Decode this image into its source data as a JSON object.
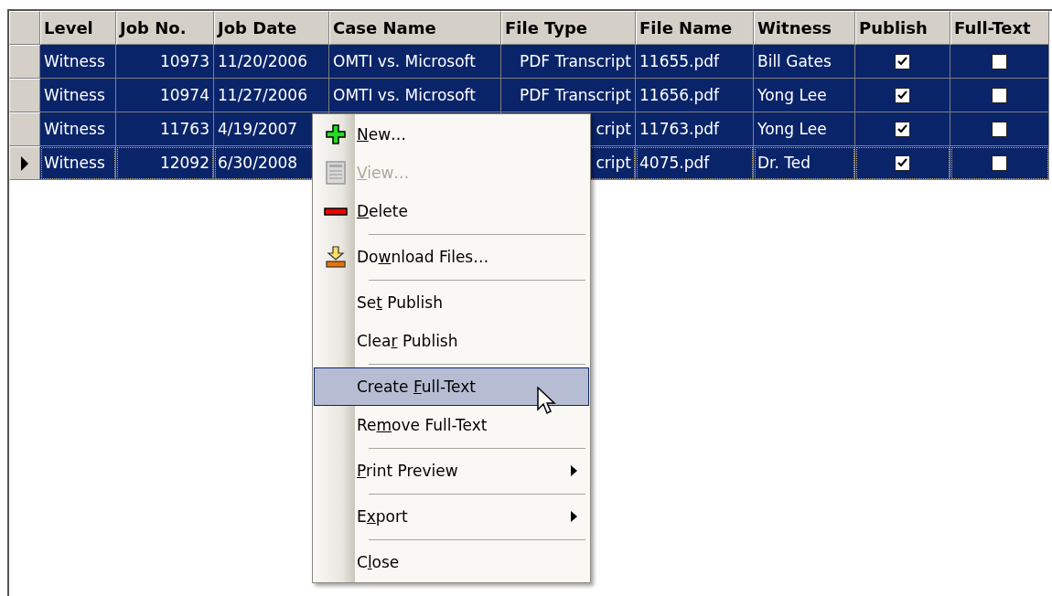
{
  "table": {
    "columns": [
      "Level",
      "Job No.",
      "Job Date",
      "Case Name",
      "File Type",
      "File Name",
      "Witness",
      "Publish",
      "Full-Text"
    ],
    "rows": [
      {
        "selected": true,
        "current": false,
        "level": "Witness",
        "job_no": "10973",
        "job_date": "11/20/2006",
        "case_name": "OMTI vs. Microsoft",
        "file_type": "PDF Transcript",
        "file_name": "11655.pdf",
        "witness": "Bill Gates",
        "publish": true,
        "full_text": false
      },
      {
        "selected": true,
        "current": false,
        "level": "Witness",
        "job_no": "10974",
        "job_date": "11/27/2006",
        "case_name": "OMTI vs. Microsoft",
        "file_type": "PDF Transcript",
        "file_name": "11656.pdf",
        "witness": "Yong Lee",
        "publish": true,
        "full_text": false
      },
      {
        "selected": true,
        "current": false,
        "level": "Witness",
        "job_no": "11763",
        "job_date": "4/19/2007",
        "file_type": "cript",
        "file_name": "11763.pdf",
        "witness": "Yong Lee",
        "publish": true,
        "full_text": false
      },
      {
        "selected": true,
        "current": true,
        "level": "Witness",
        "job_no": "12092",
        "job_date": "6/30/2008",
        "file_type": "cript",
        "file_name": "4075.pdf",
        "witness": "Dr. Ted",
        "publish": true,
        "full_text": false
      }
    ]
  },
  "context_menu": {
    "items": [
      {
        "kind": "command",
        "label": "New…",
        "disabled": false,
        "selected": false
      },
      {
        "kind": "command",
        "label": "View…",
        "disabled": true,
        "selected": false
      },
      {
        "kind": "command",
        "label": "Delete",
        "disabled": false,
        "selected": false
      },
      {
        "kind": "separator"
      },
      {
        "kind": "command",
        "label": "Download Files…",
        "disabled": false,
        "selected": false
      },
      {
        "kind": "separator"
      },
      {
        "kind": "command",
        "label": "Set Publish",
        "disabled": false,
        "selected": false
      },
      {
        "kind": "command",
        "label": "Clear Publish",
        "disabled": false,
        "selected": false
      },
      {
        "kind": "separator"
      },
      {
        "kind": "command",
        "label": "Create Full-Text",
        "disabled": false,
        "selected": true
      },
      {
        "kind": "command",
        "label": "Remove Full-Text",
        "disabled": false,
        "selected": false
      },
      {
        "kind": "separator"
      },
      {
        "kind": "submenu",
        "label": "Print Preview",
        "disabled": false,
        "selected": false
      },
      {
        "kind": "separator"
      },
      {
        "kind": "submenu",
        "label": "Export",
        "disabled": false,
        "selected": false
      },
      {
        "kind": "separator"
      },
      {
        "kind": "command",
        "label": "Close",
        "disabled": false,
        "selected": false
      }
    ]
  }
}
